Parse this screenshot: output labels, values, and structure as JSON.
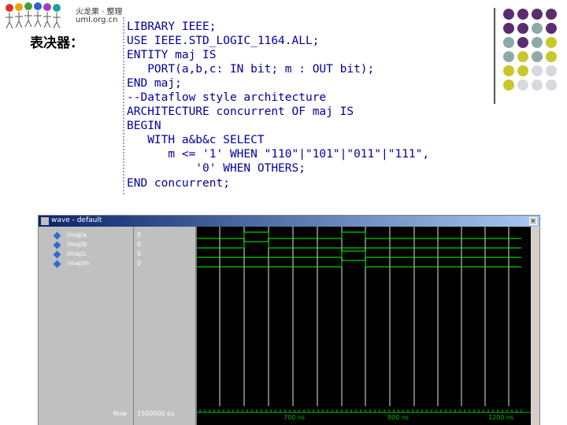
{
  "header": {
    "logo_line1": "火龙果 · 整理",
    "logo_line2": "uml.org.cn",
    "label": "表决器："
  },
  "code": {
    "lines": [
      "LIBRARY IEEE;",
      "USE IEEE.STD_LOGIC_1164.ALL;",
      "ENTITY maj IS",
      "   PORT(a,b,c: IN bit; m : OUT bit);",
      "END maj;",
      "--Dataflow style architecture",
      "ARCHITECTURE concurrent OF maj IS",
      "BEGIN",
      "   WITH a&b&c SELECT",
      "      m <= '1' WHEN \"110\"|\"101\"|\"011\"|\"111\",",
      "          '0' WHEN OTHERS;",
      "END concurrent;"
    ]
  },
  "wave": {
    "title": "wave - default",
    "signals": [
      {
        "name": "/maj/a",
        "value": "0"
      },
      {
        "name": "/maj/b",
        "value": "0"
      },
      {
        "name": "/maj/c",
        "value": "0"
      },
      {
        "name": "/maj/m",
        "value": "0"
      }
    ],
    "now_label": "Now",
    "now_value": "1500000 ps",
    "time_ticks": [
      "700 ns",
      "800 ns",
      "1200 ns"
    ],
    "colors": {
      "wave": "#00ff00",
      "grid": "#ffffff",
      "title_bar": "#0a246a"
    }
  }
}
